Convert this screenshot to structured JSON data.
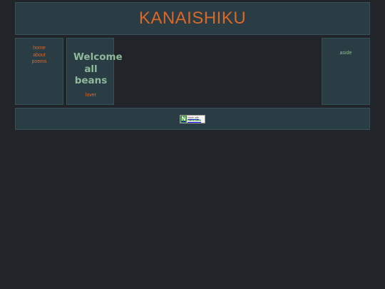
{
  "header": {
    "title": "KANAISHIKU"
  },
  "nav": {
    "items": [
      {
        "label": "home"
      },
      {
        "label": "about"
      },
      {
        "label": "poems"
      }
    ]
  },
  "main": {
    "welcome_lines": [
      "Welcome",
      "all",
      "beans"
    ],
    "link_label": "lover"
  },
  "aside": {
    "label": "aside"
  },
  "footer": {
    "badge": {
      "logo_letter": "N",
      "line1": "Made with",
      "line2": "neocities"
    }
  },
  "colors": {
    "background": "#212428",
    "panel": "#2a3c44",
    "accent": "#d9682a",
    "green_text": "#8fb99a"
  }
}
